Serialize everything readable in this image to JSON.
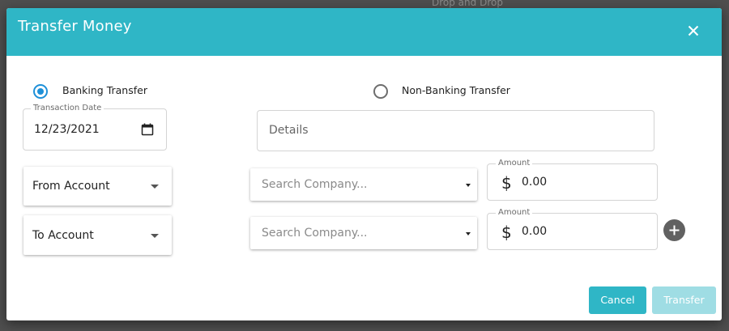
{
  "background": {
    "hint_text": "Drop and Drop"
  },
  "dialog": {
    "title": "Transfer Money",
    "header_color": "#2fb6c6",
    "close_icon": "close-icon"
  },
  "transfer_type": {
    "options": [
      {
        "label": "Banking Transfer",
        "selected": true
      },
      {
        "label": "Non-Banking Transfer",
        "selected": false
      }
    ],
    "accent_color": "#1e90d8"
  },
  "transaction_date": {
    "label": "Transaction Date",
    "value": "12/23/2021",
    "icon": "calendar-icon"
  },
  "details": {
    "placeholder": "Details"
  },
  "rows": [
    {
      "account_select": "From Account",
      "company_placeholder": "Search Company...",
      "amount_label": "Amount",
      "currency_symbol": "$",
      "amount_value": "0.00"
    },
    {
      "account_select": "To Account",
      "company_placeholder": "Search Company...",
      "amount_label": "Amount",
      "currency_symbol": "$",
      "amount_value": "0.00"
    }
  ],
  "add_row_icon": "plus-icon",
  "buttons": {
    "cancel": "Cancel",
    "transfer": "Transfer",
    "transfer_disabled": true
  }
}
